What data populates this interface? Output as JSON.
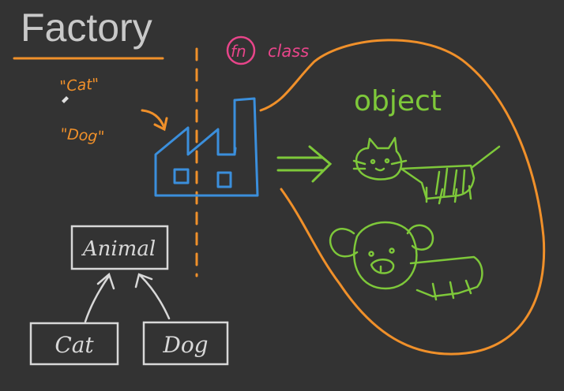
{
  "title": "Factory",
  "inputs": {
    "cat": "\"Cat\"",
    "dog": "\"Dog\""
  },
  "fn_label": "fn",
  "class_label": "class",
  "output_label": "object",
  "hierarchy": {
    "parent": "Animal",
    "child_left": "Cat",
    "child_right": "Dog"
  },
  "colors": {
    "background": "#333333",
    "title": "#c9c9c9",
    "underline": "#f0902a",
    "orange": "#f0902a",
    "factory": "#3b8fdc",
    "green": "#7ec83a",
    "pink": "#e8458a",
    "white": "#d8d8d8"
  },
  "icons": [
    "factory-icon",
    "cat-drawing-icon",
    "dog-drawing-icon",
    "implies-arrow-icon",
    "curved-arrow-icon"
  ]
}
